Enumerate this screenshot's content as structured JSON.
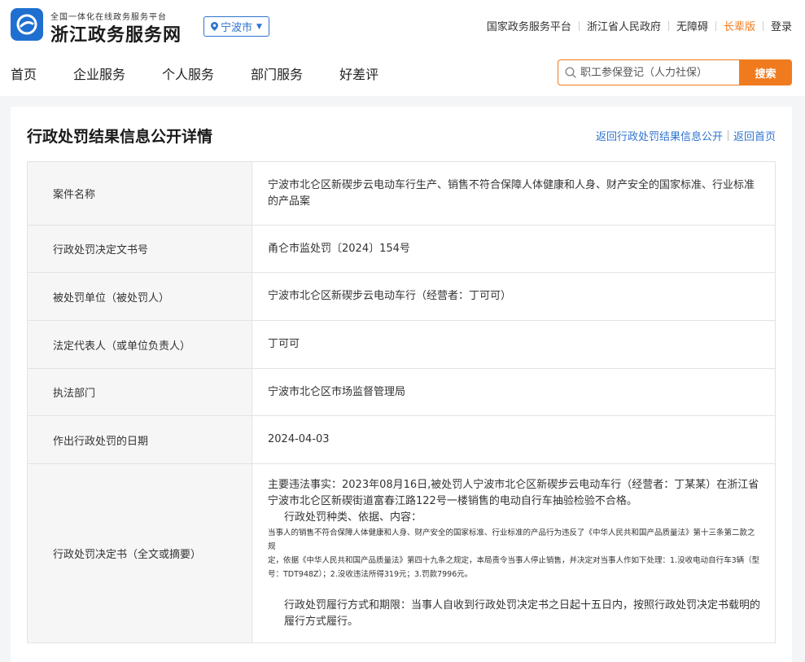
{
  "header": {
    "brand_sub": "全国一体化在线政务服务平台",
    "brand_main": "浙江政务服务网",
    "city": "宁波市",
    "links": [
      {
        "label": "国家政务服务平台"
      },
      {
        "label": "浙江省人民政府"
      },
      {
        "label": "无障碍"
      },
      {
        "label": "长辈版",
        "accent": true
      },
      {
        "label": "登录"
      }
    ],
    "nav": [
      "首页",
      "企业服务",
      "个人服务",
      "部门服务",
      "好差评"
    ],
    "search": {
      "placeholder": "职工参保登记（人力社保）",
      "button": "搜索"
    }
  },
  "page": {
    "title": "行政处罚结果信息公开详情",
    "crumb_back": "返回行政处罚结果信息公开",
    "crumb_home": "返回首页"
  },
  "rows": [
    {
      "label": "案件名称",
      "value": "宁波市北仑区新碶步云电动车行生产、销售不符合保障人体健康和人身、财产安全的国家标准、行业标准的产品案"
    },
    {
      "label": "行政处罚决定文书号",
      "value": "甬仑市监处罚〔2024〕154号"
    },
    {
      "label": "被处罚单位（被处罚人）",
      "value": "宁波市北仑区新碶步云电动车行（经营者：丁可可）"
    },
    {
      "label": "法定代表人（或单位负责人）",
      "value": "丁可可"
    },
    {
      "label": "执法部门",
      "value": "宁波市北仑区市场监督管理局"
    },
    {
      "label": "作出行政处罚的日期",
      "value": "2024-04-03"
    }
  ],
  "decision": {
    "label": "行政处罚决定书（全文或摘要）",
    "p1": "主要违法事实：2023年08月16日,被处罚人宁波市北仑区新碶步云电动车行（经营者：丁某某）在浙江省宁波市北仑区新碶街道富春江路122号一楼销售的电动自行车抽验检验不合格。",
    "p2": "行政处罚种类、依据、内容：",
    "small1": "当事人的销售不符合保障人体健康和人身、财产安全的国家标准、行业标准的产品行为违反了《中华人民共和国产品质量法》第十三条第二款之规",
    "small2": "定，依据《中华人民共和国产品质量法》第四十九条之规定，本局责令当事人停止销售，并决定对当事人作如下处理：1.没收电动自行车3辆（型号：TDT948Z）；2.没收违法所得319元；3.罚款7996元。",
    "p3": "行政处罚履行方式和期限：当事人自收到行政处罚决定书之日起十五日内，按照行政处罚决定书载明的履行方式履行。"
  },
  "colors": {
    "accent": "#f07b1e",
    "link": "#2f74d0",
    "brand": "#1f6fd1"
  }
}
